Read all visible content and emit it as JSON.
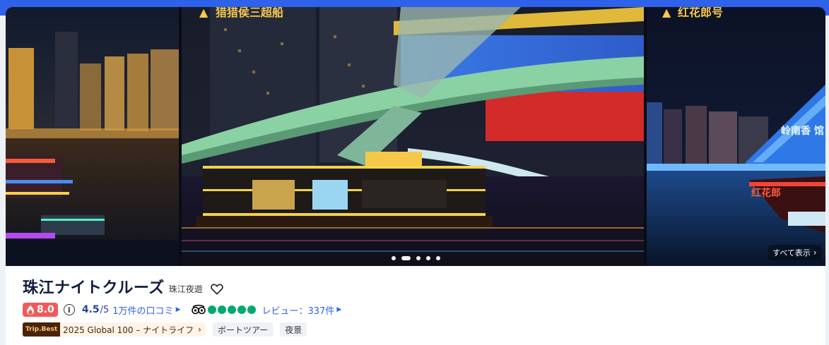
{
  "gallery": {
    "images": [
      {
        "name": "river-city-night-left"
      },
      {
        "name": "cruise-boat-under-bridge"
      },
      {
        "name": "illuminated-cruise-right"
      }
    ],
    "photo_signs": {
      "middle_sign": "猎猎侯三超船",
      "right_sign": "红花郎号",
      "right_boat_sign": "红花郎",
      "right_wall_sign": "岭南香 馆"
    },
    "pagination_count": 5,
    "active_index": 1,
    "show_all_label": "すべて表示"
  },
  "product": {
    "title": "珠江ナイトクルーズ",
    "subtitle": "珠江夜遊"
  },
  "rating": {
    "trip_score": "8.0",
    "score_value": "4.5",
    "score_max": "/5",
    "reviews_label": "1万件の口コミ",
    "ta_bubbles": 5,
    "ta_reviews_label": "レビュー：337件"
  },
  "tags": {
    "award_logo": "Trip.Best",
    "award_label": "2025 Global 100 – ナイトライフ",
    "items": [
      "ボートツアー",
      "夜景"
    ]
  },
  "colors": {
    "brand_blue": "#2e62ea",
    "score_red": "#ef5b5b",
    "tripadvisor_green": "#00aa6c"
  }
}
